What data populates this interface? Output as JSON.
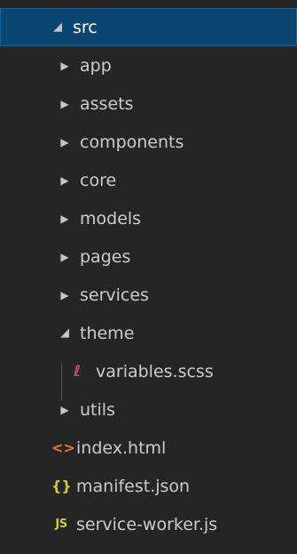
{
  "explorer": {
    "root": {
      "label": "src",
      "expanded": true,
      "twisty_icon": "chevron-down-icon"
    },
    "items": [
      {
        "label": "app",
        "kind": "folder",
        "icon": "chevron-right-icon"
      },
      {
        "label": "assets",
        "kind": "folder",
        "icon": "chevron-right-icon"
      },
      {
        "label": "components",
        "kind": "folder",
        "icon": "chevron-right-icon"
      },
      {
        "label": "core",
        "kind": "folder",
        "icon": "chevron-right-icon"
      },
      {
        "label": "models",
        "kind": "folder",
        "icon": "chevron-right-icon"
      },
      {
        "label": "pages",
        "kind": "folder",
        "icon": "chevron-right-icon"
      },
      {
        "label": "services",
        "kind": "folder",
        "icon": "chevron-right-icon"
      },
      {
        "label": "theme",
        "kind": "folder",
        "expanded": true,
        "icon": "chevron-down-icon",
        "children": [
          {
            "label": "variables.scss",
            "kind": "file",
            "icon": "sass-file-icon",
            "icon_glyph": "ℓ"
          }
        ]
      },
      {
        "label": "utils",
        "kind": "folder",
        "icon": "chevron-right-icon"
      },
      {
        "label": "index.html",
        "kind": "file",
        "icon": "html-file-icon",
        "icon_glyph": "<>"
      },
      {
        "label": "manifest.json",
        "kind": "file",
        "icon": "json-file-icon",
        "icon_glyph": "{}"
      },
      {
        "label": "service-worker.js",
        "kind": "file",
        "icon": "js-file-icon",
        "icon_glyph": "JS"
      }
    ]
  },
  "colors": {
    "background": "#252526",
    "selected_background": "#094771",
    "text": "#cccccc",
    "html_icon": "#e37933",
    "json_icon": "#cbcb41",
    "js_icon": "#cbcb41",
    "scss_icon": "#cd4f6f"
  }
}
